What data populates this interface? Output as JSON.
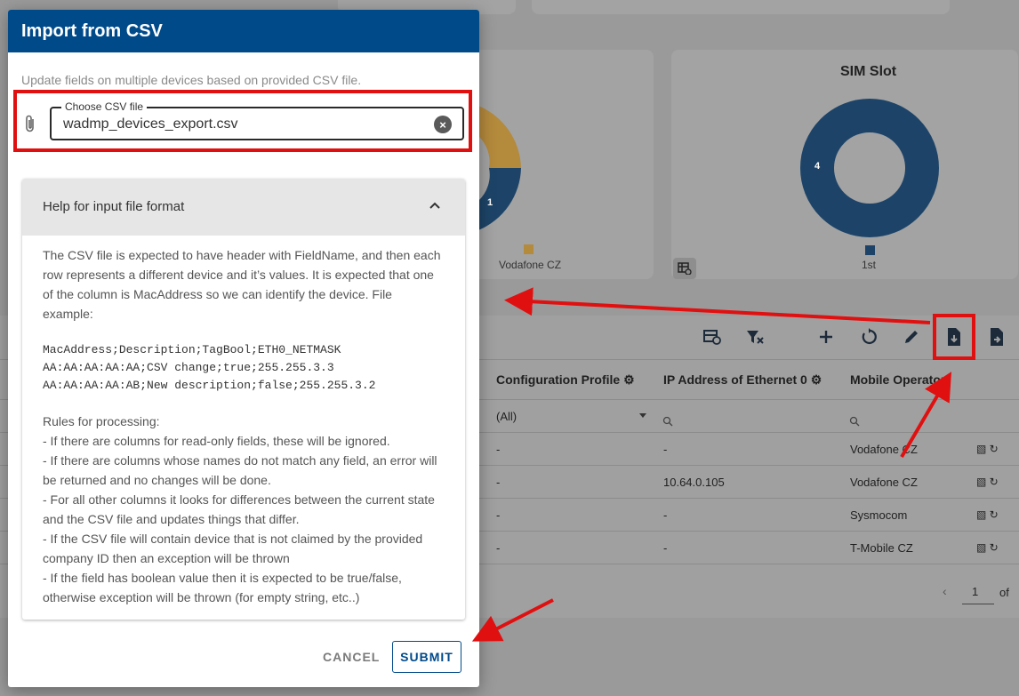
{
  "dialog": {
    "title": "Import from CSV",
    "description": "Update fields on multiple devices based on provided CSV file.",
    "file_label": "Choose CSV file",
    "file_value": "wadmp_devices_export.csv",
    "help_title": "Help for input file format",
    "help_paragraph": "The CSV file is expected to have header with FieldName, and then each row represents a different device and it’s values. It is expected that one of the column is MacAddress so we can identify the device. File example:",
    "code_lines": [
      "MacAddress;Description;TagBool;ETH0_NETMASK",
      "AA:AA:AA:AA:AA;CSV change;true;255.255.3.3",
      "AA:AA:AA:AA:AB;New description;false;255.255.3.2"
    ],
    "rules_title": "Rules for processing:",
    "rules": [
      "- If there are columns for read-only fields, these will be ignored.",
      "- If there are columns whose names do not match any field, an error will be returned and no changes will be done.",
      "- For all other columns it looks for differences between the current state and the CSV file and updates things that differ.",
      "- If the CSV file will contain device that is not claimed by the provided company ID then an exception will be thrown",
      "- If the field has boolean value then it is expected to be true/false, otherwise exception will be thrown (for empty string, etc..)"
    ],
    "cancel_label": "CANCEL",
    "submit_label": "SUBMIT"
  },
  "background": {
    "chart1_value": "1",
    "chart1_legend": "Vodafone CZ",
    "chart2_title": "SIM Slot",
    "chart2_value": "4",
    "chart2_legend": "1st",
    "columns": [
      "Configuration Profile",
      "IP Address of Ethernet 0",
      "Mobile Operator"
    ],
    "filter_all": "(All)",
    "rows": [
      {
        "profile": "-",
        "ip": "-",
        "operator": "Vodafone CZ"
      },
      {
        "profile": "-",
        "ip": "10.64.0.105",
        "operator": "Vodafone CZ"
      },
      {
        "profile": "-",
        "ip": "-",
        "operator": "Sysmocom"
      },
      {
        "profile": "-",
        "ip": "-",
        "operator": "T-Mobile CZ"
      }
    ],
    "page_number": "1",
    "page_of": "of"
  },
  "colors": {
    "header_blue": "#014a8a",
    "annotation_red": "#e01010",
    "donut_blue": "#0d4a86",
    "donut_orange": "#d8941a"
  }
}
